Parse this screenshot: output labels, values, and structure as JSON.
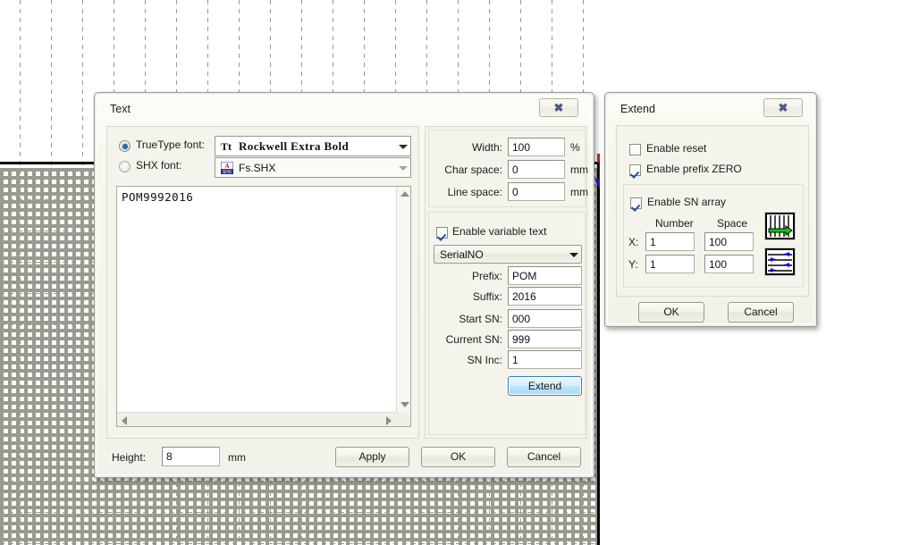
{
  "canvas": {
    "name": "cad-drawing-canvas"
  },
  "text_dialog": {
    "title": "Text",
    "close_glyph": "✖",
    "font_section": {
      "truetype_label": "TrueType font:",
      "shx_label": "SHX font:",
      "truetype_selected": true,
      "shx_selected": false,
      "truetype_value": "Rockwell Extra Bold",
      "truetype_icon": "Tt",
      "shx_value": "Fs.SHX",
      "shx_icon": "shx-font-icon"
    },
    "editor": {
      "content": "POM9992016"
    },
    "metrics": {
      "width_label": "Width:",
      "width_value": "100",
      "width_unit": "%",
      "char_space_label": "Char space:",
      "char_space_value": "0",
      "char_space_unit": "mm",
      "line_space_label": "Line space:",
      "line_space_value": "0",
      "line_space_unit": "mm"
    },
    "variable": {
      "enable_label": "Enable variable text",
      "enabled": true,
      "type_value": "SerialNO",
      "prefix_label": "Prefix:",
      "prefix_value": "POM",
      "suffix_label": "Suffix:",
      "suffix_value": "2016",
      "start_sn_label": "Start SN:",
      "start_sn_value": "000",
      "current_sn_label": "Current SN:",
      "current_sn_value": "999",
      "sn_inc_label": "SN Inc:",
      "sn_inc_value": "1",
      "extend_button": "Extend"
    },
    "footer": {
      "height_label": "Height:",
      "height_value": "8",
      "height_unit": "mm",
      "apply_button": "Apply",
      "ok_button": "OK",
      "cancel_button": "Cancel"
    }
  },
  "extend_dialog": {
    "title": "Extend",
    "close_glyph": "✖",
    "enable_reset_label": "Enable reset",
    "enable_reset_checked": false,
    "enable_prefix_zero_label": "Enable prefix ZERO",
    "enable_prefix_zero_checked": true,
    "enable_sn_array_label": "Enable SN array",
    "enable_sn_array_checked": true,
    "number_header": "Number",
    "space_header": "Space",
    "x_label": "X:",
    "x_number": "1",
    "x_space": "100",
    "y_label": "Y:",
    "y_number": "1",
    "y_space": "100",
    "icon_unidirectional": "array-scan-unidirectional-icon",
    "icon_bidirectional": "array-scan-bidirectional-icon",
    "ok_button": "OK",
    "cancel_button": "Cancel"
  },
  "colors": {
    "accent_blue": "#3c7fb1",
    "arrow_blue": "#1a1ae6",
    "handle_red": "#e01b1b",
    "array_green": "#00d000",
    "grid_gray": "#9a9a90"
  }
}
